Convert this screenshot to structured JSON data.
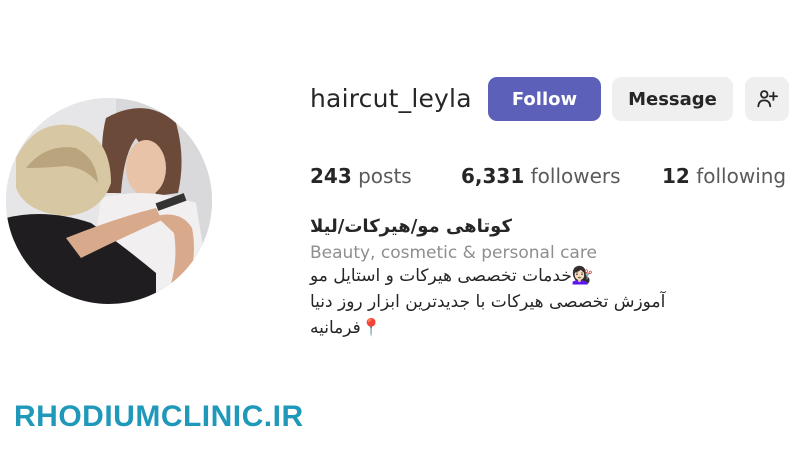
{
  "profile": {
    "username": "haircut_leyla",
    "follow_label": "Follow",
    "message_label": "Message",
    "suggest_icon": "person-add-icon"
  },
  "stats": {
    "posts_count": "243",
    "posts_label": "posts",
    "followers_count": "6,331",
    "followers_label": "followers",
    "following_count": "12",
    "following_label": "following"
  },
  "bio": {
    "name": "کوتاهی مو/هیرکات/لیلا",
    "category": "Beauty, cosmetic & personal care",
    "line1": "💇🏻‍♀️خدمات تخصصی هیرکات و استایل مو",
    "line2": "آموزش تخصصی هیرکات با جدیدترین ابزار روز دنیا",
    "line3": "📍فرمانیه"
  },
  "watermark": "RHODIUMCLINIC.IR",
  "colors": {
    "accent": "#5c60b9",
    "watermark": "#1f98ba",
    "button_bg": "#efefef"
  }
}
